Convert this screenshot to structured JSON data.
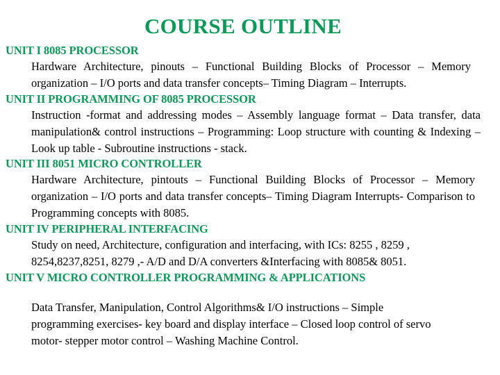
{
  "slide": {
    "title": "COURSE OUTLINE",
    "accent_color": "#0b9a57",
    "text_color": "#000000",
    "background_color": "#ffffff",
    "units": [
      {
        "heading": "UNIT I 8085 PROCESSOR",
        "body": "Hardware Architecture, pinouts – Functional Building Blocks of Processor – Memory organization – I/O ports and data transfer concepts– Timing Diagram – Interrupts."
      },
      {
        "heading": "UNIT II PROGRAMMING OF 8085 PROCESSOR",
        "body": "Instruction -format and addressing modes – Assembly language format – Data transfer, data manipulation& control instructions – Programming: Loop structure with counting & Indexing – Look up table - Subroutine instructions - stack."
      },
      {
        "heading": "UNIT III 8051 MICRO CONTROLLER",
        "body": "Hardware Architecture, pintouts – Functional Building Blocks of Processor – Memory organization – I/O ports and data transfer concepts– Timing Diagram Interrupts- Comparison to Programming  concepts with 8085."
      },
      {
        "heading": "UNIT IV PERIPHERAL INTERFACING",
        "body": "Study on need, Architecture, configuration and interfacing, with ICs: 8255 , 8259 , 8254,8237,8251, 8279 ,- A/D and D/A converters &Interfacing with 8085& 8051."
      },
      {
        "heading": "UNIT V MICRO CONTROLLER PROGRAMMING & APPLICATIONS",
        "body": "Data Transfer, Manipulation, Control Algorithms& I/O instructions – Simple programming exercises- key board and display interface – Closed loop control of servo motor- stepper motor control – Washing Machine Control."
      }
    ]
  }
}
